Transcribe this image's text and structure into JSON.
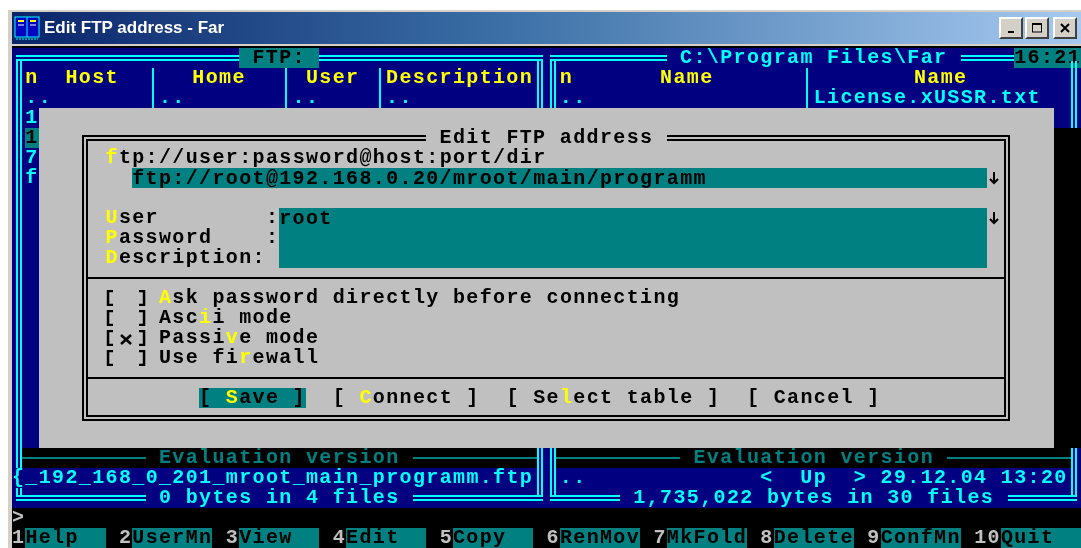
{
  "window": {
    "title": "Edit FTP address - Far"
  },
  "clock": "16:21",
  "panels": [
    {
      "title": " FTP: ",
      "active": true,
      "sort_indicator": "n",
      "columns": [
        {
          "heading": "Host"
        },
        {
          "heading": "Home"
        },
        {
          "heading": "User"
        },
        {
          "heading": "Description"
        }
      ],
      "rows": [
        {
          "cells": [
            "..",
            "..",
            "..",
            ".."
          ],
          "selected": false
        },
        {
          "cells": [
            "1"
          ],
          "selected": false
        },
        {
          "cells": [
            "1"
          ],
          "selected": true
        },
        {
          "cells": [
            "7"
          ],
          "selected": false
        },
        {
          "cells": [
            "f"
          ],
          "selected": false
        }
      ],
      "separator": "Evaluation version",
      "info": {
        "name": "{_192_168_0_201_mroot_main_programm.ftp"
      },
      "summary": "0 bytes in 4 files"
    },
    {
      "title": " C:\\Program Files\\Far ",
      "active": false,
      "sort_indicator": "n",
      "columns": [
        {
          "heading": "Name"
        },
        {
          "heading": "Name"
        }
      ],
      "rows": [
        {
          "cells": [
            "..",
            "License.xUSSR.txt"
          ],
          "selected": false
        }
      ],
      "separator": "Evaluation version",
      "info": {
        "name": "..",
        "size": "<  Up  >",
        "date": "29.12.04 13:20"
      },
      "summary": "1,735,022 bytes in 30 files"
    }
  ],
  "dialog": {
    "title": "Edit FTP address",
    "url_label": "**f**tp://user:password@host:port/dir",
    "url": "ftp://root@192.168.0.20/mroot/main/programm",
    "url_history": true,
    "fields": [
      {
        "label": "**U**ser        :",
        "value": "root",
        "history": true
      },
      {
        "label": "**P**assword    :"
      },
      {
        "label": "**D**escription:"
      }
    ],
    "checks": [
      {
        "label": "**A**sk password directly before connecting",
        "checked": false
      },
      {
        "label": "Asc**i**i mode",
        "checked": false
      },
      {
        "label": "Passi**v**e mode",
        "checked": true
      },
      {
        "label": "Use fi**r**ewall",
        "checked": false
      }
    ],
    "buttons": [
      {
        "label": "[ **S**ave ]",
        "focused": true
      },
      {
        "label": "[ **C**onnect ]",
        "focused": false
      },
      {
        "label": "[ Se**l**ect table ]",
        "focused": false
      },
      {
        "label": "[ Cancel ]",
        "focused": false
      }
    ]
  },
  "prompt": ">",
  "keybar": [
    {
      "key": "1",
      "label": "Help"
    },
    {
      "key": "2",
      "label": "UserMn"
    },
    {
      "key": "3",
      "label": "View"
    },
    {
      "key": "4",
      "label": "Edit"
    },
    {
      "key": "5",
      "label": "Copy"
    },
    {
      "key": "6",
      "label": "RenMov"
    },
    {
      "key": "7",
      "label": "MkFold"
    },
    {
      "key": "8",
      "label": "Delete"
    },
    {
      "key": "9",
      "label": "ConfMn"
    },
    {
      "key": "10",
      "label": "Quit"
    }
  ]
}
